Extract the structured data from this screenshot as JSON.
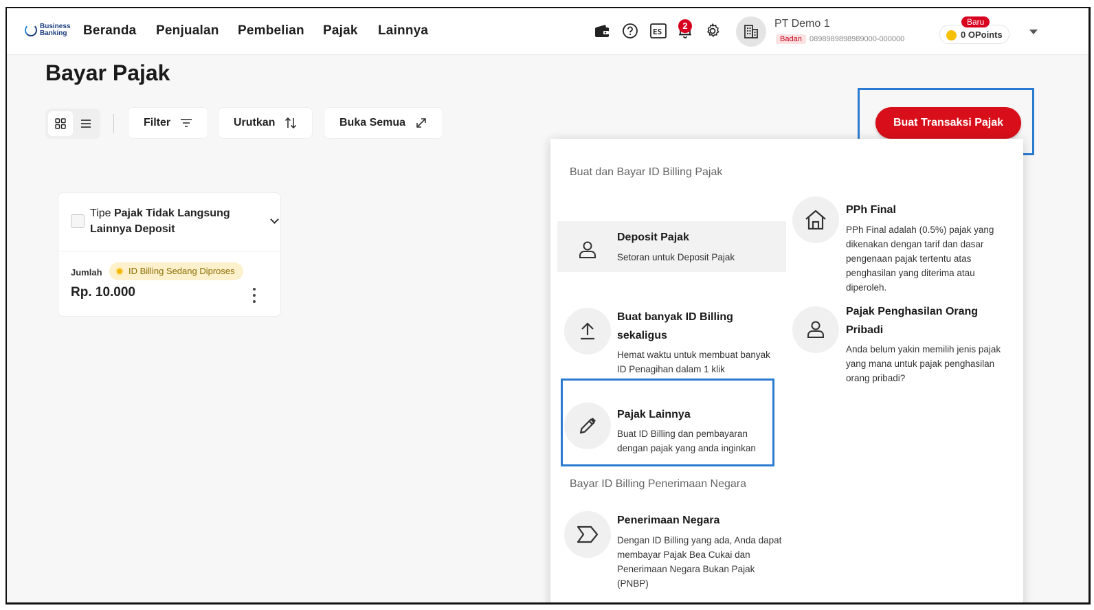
{
  "brand": {
    "logo_line1": "Business",
    "logo_line2": "Banking"
  },
  "nav": {
    "items": [
      "Beranda",
      "Penjualan",
      "Pembelian",
      "Pajak",
      "Lainnya"
    ]
  },
  "header": {
    "notification_count": "2",
    "company_name": "PT Demo 1",
    "company_type": "Badan",
    "company_id": "0898989898989000-000000",
    "points_new_badge": "Baru",
    "points_label": "0 OPoints"
  },
  "page": {
    "title": "Bayar Pajak"
  },
  "toolbar": {
    "filter": "Filter",
    "sort": "Urutkan",
    "open_all": "Buka Semua",
    "create": "Buat Transaksi Pajak"
  },
  "card": {
    "title_prefix": "Tipe ",
    "title_bold": "Pajak Tidak Langsung Lainnya Deposit",
    "amount_label": "Jumlah",
    "status": "ID Billing Sedang Diproses",
    "amount": "Rp. 10.000"
  },
  "menu": {
    "section1": "Buat dan Bayar ID Billing Pajak",
    "section2": "Bayar ID Billing Penerimaan Negara",
    "items": [
      {
        "title": "Deposit Pajak",
        "desc": "Setoran untuk Deposit Pajak",
        "icon": "person-icon"
      },
      {
        "title": "PPh Final",
        "desc": "PPh Final adalah (0.5%) pajak yang dikenakan dengan tarif dan dasar pengenaan pajak tertentu atas penghasilan yang diterima atau diperoleh.",
        "icon": "home-icon"
      },
      {
        "title": "Buat banyak ID Billing sekaligus",
        "desc": "Hemat waktu untuk membuat banyak ID Penagihan dalam 1 klik",
        "icon": "upload-icon"
      },
      {
        "title": "Pajak Penghasilan Orang Pribadi",
        "desc": "Anda belum yakin memilih jenis pajak yang mana untuk pajak penghasilan orang pribadi?",
        "icon": "person-icon"
      },
      {
        "title": "Pajak Lainnya",
        "desc": "Buat ID Billing dan pembayaran dengan pajak yang anda inginkan",
        "icon": "pencil-icon"
      },
      {
        "title": "Penerimaan Negara",
        "desc": "Dengan ID Billing yang ada, Anda dapat membayar Pajak Bea Cukai dan Penerimaan Negara Bukan Pajak (PNBP)",
        "icon": "arrow-tag-icon"
      }
    ]
  },
  "colors": {
    "primary": "#d80f1a",
    "highlight": "#2a7bd0",
    "status_bg": "#fdf0cc"
  }
}
